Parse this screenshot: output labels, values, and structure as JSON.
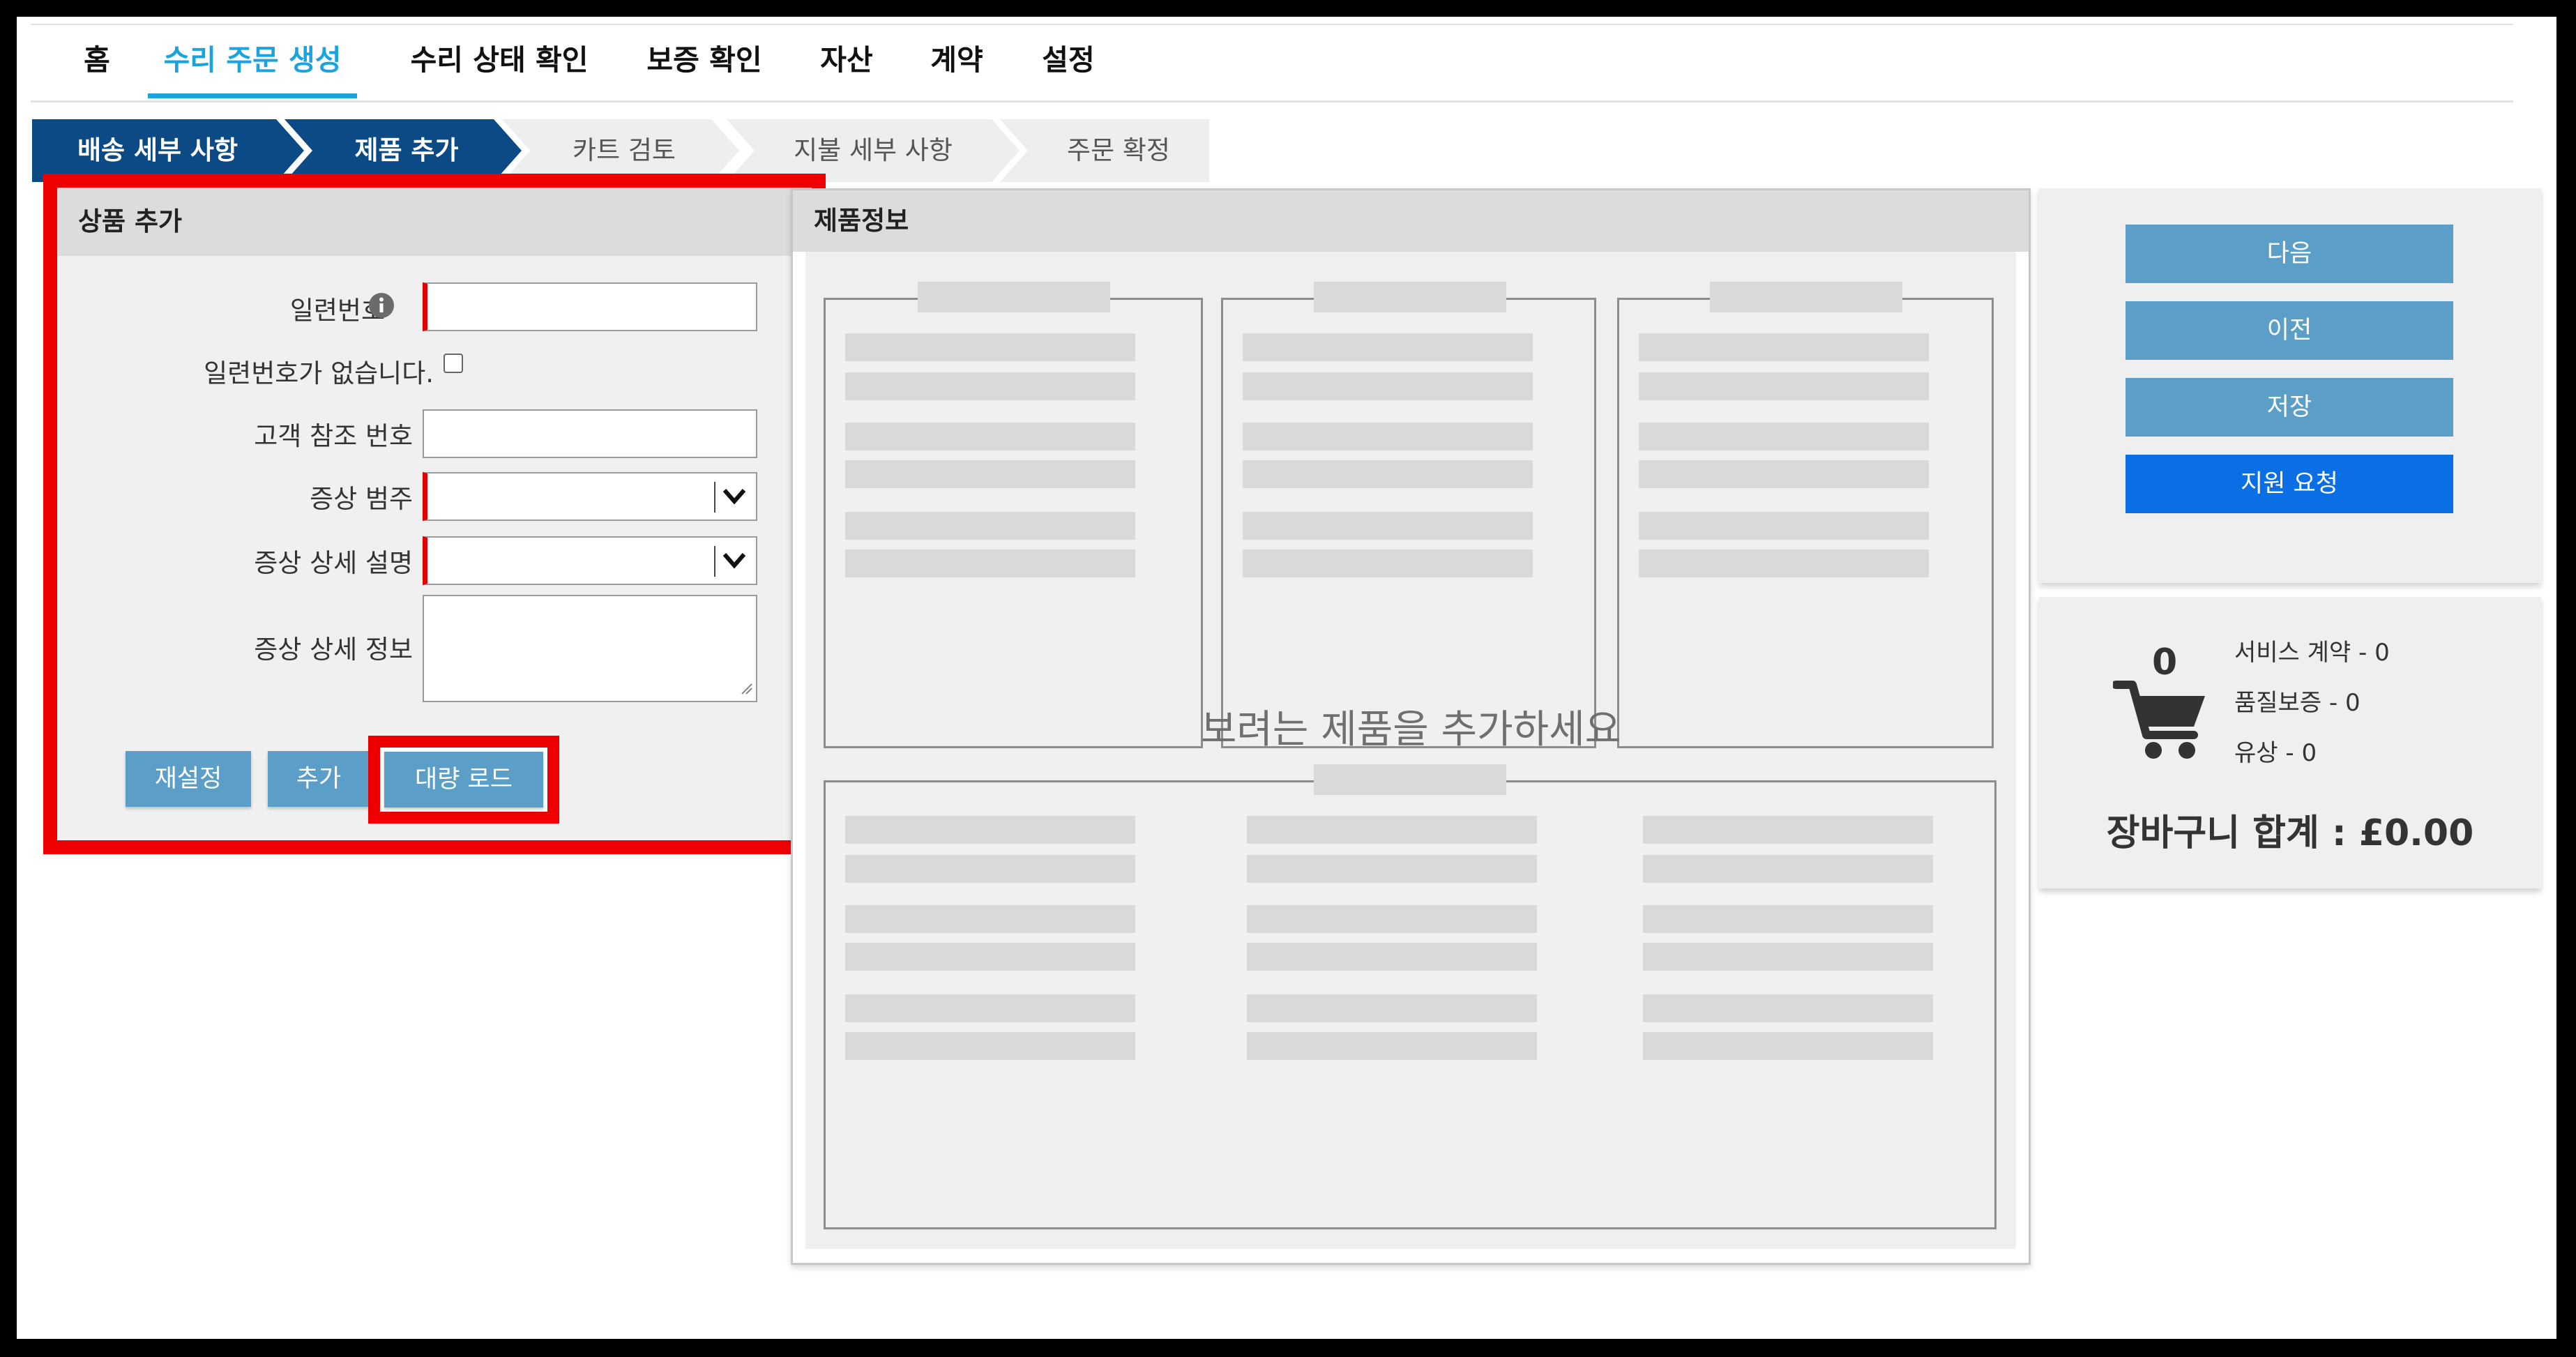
{
  "nav": {
    "items": [
      {
        "label": "홈"
      },
      {
        "label": "수리 주문 생성",
        "active": true
      },
      {
        "label": "수리 상태 확인"
      },
      {
        "label": "보증 확인"
      },
      {
        "label": "자산"
      },
      {
        "label": "계약"
      },
      {
        "label": "설정"
      }
    ]
  },
  "steps": [
    {
      "label": "배송 세부 사항",
      "status": "done"
    },
    {
      "label": "제품 추가",
      "status": "done"
    },
    {
      "label": "카트 검토",
      "status": "todo"
    },
    {
      "label": "지불 세부 사항",
      "status": "todo"
    },
    {
      "label": "주문 확정",
      "status": "todo"
    }
  ],
  "add_product": {
    "title": "상품 추가",
    "serial_label": "일련번호",
    "serial_value": "",
    "no_serial_label": "일련번호가 없습니다.",
    "no_serial_checked": false,
    "customer_ref_label": "고객 참조 번호",
    "customer_ref_value": "",
    "symptom_category_label": "증상 범주",
    "symptom_category_value": "",
    "symptom_desc_label": "증상 상세 설명",
    "symptom_desc_value": "",
    "symptom_info_label": "증상 상세 정보",
    "symptom_info_value": "",
    "reset_label": "재설정",
    "add_label": "추가",
    "bulk_label": "대량 로드"
  },
  "product_info": {
    "title": "제품정보",
    "placeholder": "보려는 제품을 추가하세요"
  },
  "actions": {
    "next": "다음",
    "prev": "이전",
    "save": "저장",
    "support": "지원 요청"
  },
  "cart": {
    "count": "0",
    "service_contract": "서비스 계약 - 0",
    "warranty": "품질보증 - 0",
    "paid": "유상 - 0",
    "total": "장바구니 합계 : £0.00"
  },
  "colors": {
    "accent": "#1aa3dd",
    "step_done": "#0b4a84",
    "step_todo": "#eeeeee",
    "highlight": "#ee0000",
    "button": "#5b9fc8",
    "button_primary": "#0a6fe5"
  }
}
